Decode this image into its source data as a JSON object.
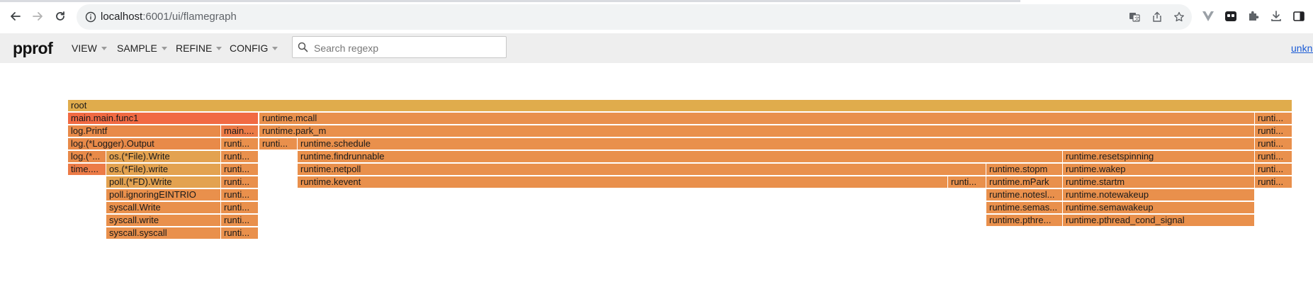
{
  "browser": {
    "url_host": "localhost",
    "url_path": ":6001/ui/flamegraph"
  },
  "header": {
    "logo": "pprof",
    "menus": [
      {
        "label": "VIEW"
      },
      {
        "label": "SAMPLE"
      },
      {
        "label": "REFINE"
      },
      {
        "label": "CONFIG"
      }
    ],
    "search": {
      "placeholder": "Search regexp",
      "value": ""
    },
    "user_link": "unknown"
  },
  "flamegraph": {
    "levels": [
      [
        {
          "label": "root",
          "color": "#e0ac4c"
        }
      ],
      [
        {
          "label": "main.main.func1",
          "color": "#f16a43"
        },
        {
          "label": "runtime.mcall",
          "color": "#e9904c"
        },
        {
          "label": "runti...",
          "color": "#e9904c"
        }
      ],
      [
        {
          "label": "log.Printf",
          "color": "#e88a49"
        },
        {
          "label": "main....",
          "color": "#ec7b47"
        },
        {
          "label": "runtime.park_m",
          "color": "#e9904c"
        },
        {
          "label": "runti...",
          "color": "#e9904c"
        }
      ],
      [
        {
          "label": "log.(*Logger).Output",
          "color": "#e88a49"
        },
        {
          "label": "runti...",
          "color": "#e9904c"
        },
        {
          "label": "runti...",
          "color": "#e9904c"
        },
        {
          "label": "runtime.schedule",
          "color": "#e9904c"
        },
        {
          "label": "runti...",
          "color": "#e9904c"
        }
      ],
      [
        {
          "label": "log.(*...",
          "color": "#e88a49"
        },
        {
          "label": "os.(*File).Write",
          "color": "#e3a250"
        },
        {
          "label": "runti...",
          "color": "#e9904c"
        },
        {
          "label": "runtime.findrunnable",
          "color": "#e9904c"
        },
        {
          "label": "runtime.resetspinning",
          "color": "#e9904c"
        },
        {
          "label": "runti...",
          "color": "#e9904c"
        }
      ],
      [
        {
          "label": "time....",
          "color": "#ec7b47"
        },
        {
          "label": "os.(*File).write",
          "color": "#e3a250"
        },
        {
          "label": "runti...",
          "color": "#e9904c"
        },
        {
          "label": "runtime.netpoll",
          "color": "#e9904c"
        },
        {
          "label": "runtime.stopm",
          "color": "#e9904c"
        },
        {
          "label": "runtime.wakep",
          "color": "#e9904c"
        },
        {
          "label": "runti...",
          "color": "#e9904c"
        }
      ],
      [
        {
          "label": "poll.(*FD).Write",
          "color": "#e3a250"
        },
        {
          "label": "runti...",
          "color": "#e9904c"
        },
        {
          "label": "runtime.kevent",
          "color": "#e9904c"
        },
        {
          "label": "runti...",
          "color": "#e9904c"
        },
        {
          "label": "runtime.mPark",
          "color": "#e9904c"
        },
        {
          "label": "runtime.startm",
          "color": "#e9904c"
        },
        {
          "label": "runti...",
          "color": "#e9904c"
        }
      ],
      [
        {
          "label": "poll.ignoringEINTRIO",
          "color": "#e9904c"
        },
        {
          "label": "runti...",
          "color": "#e9904c"
        },
        {
          "label": "runtime.notesl...",
          "color": "#e9904c"
        },
        {
          "label": "runtime.notewakeup",
          "color": "#e9904c"
        }
      ],
      [
        {
          "label": "syscall.Write",
          "color": "#e9904c"
        },
        {
          "label": "runti...",
          "color": "#e9904c"
        },
        {
          "label": "runtime.semas...",
          "color": "#e9904c"
        },
        {
          "label": "runtime.semawakeup",
          "color": "#e9904c"
        }
      ],
      [
        {
          "label": "syscall.write",
          "color": "#e9904c"
        },
        {
          "label": "runti...",
          "color": "#e9904c"
        },
        {
          "label": "runtime.pthre...",
          "color": "#e9904c"
        },
        {
          "label": "runtime.pthread_cond_signal",
          "color": "#e9904c"
        }
      ],
      [
        {
          "label": "syscall.syscall",
          "color": "#e9904c"
        },
        {
          "label": "runti...",
          "color": "#e9904c"
        }
      ]
    ]
  }
}
